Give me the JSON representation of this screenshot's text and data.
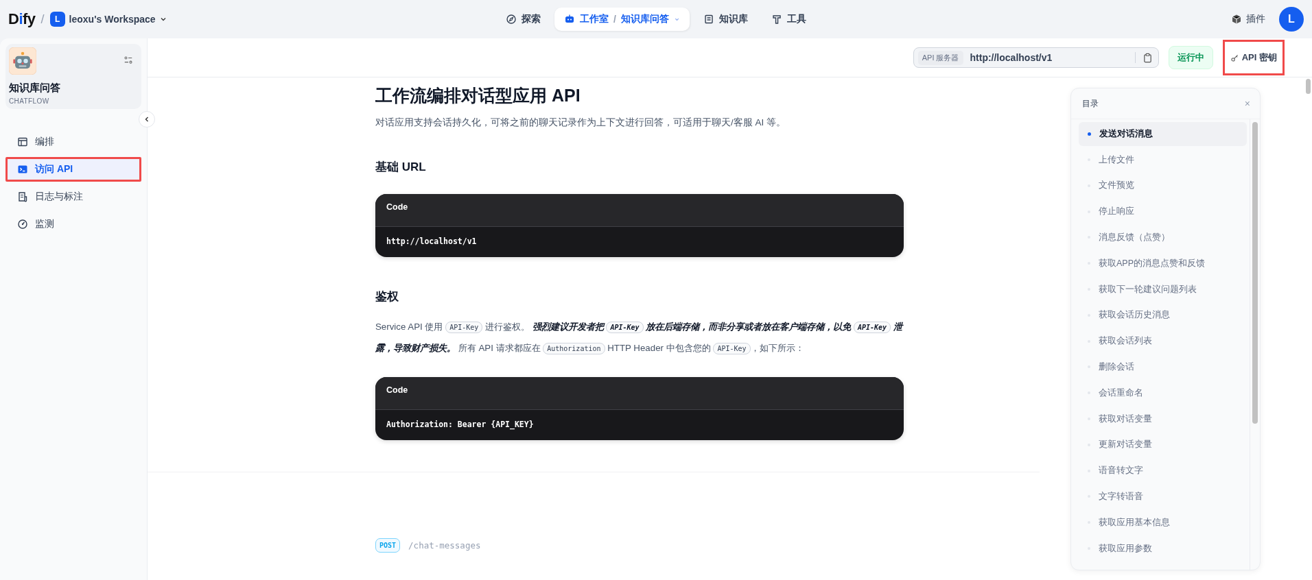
{
  "topbar": {
    "logo": "Dify",
    "separator": "/",
    "workspace": {
      "initial": "L",
      "name": "leoxu's Workspace"
    },
    "nav": [
      {
        "label": "探索",
        "selected": false
      },
      {
        "label": "工作室",
        "selected": true,
        "separator": "/",
        "sub": "知识库问答"
      },
      {
        "label": "知识库",
        "selected": false
      },
      {
        "label": "工具",
        "selected": false
      }
    ],
    "plugins": "插件",
    "avatar": "L"
  },
  "sidebar": {
    "app_name": "知识库问答",
    "app_type": "CHATFLOW",
    "items": [
      {
        "label": "编排",
        "selected": false,
        "highlighted": false
      },
      {
        "label": "访问 API",
        "selected": true,
        "highlighted": true
      },
      {
        "label": "日志与标注",
        "selected": false,
        "highlighted": false
      },
      {
        "label": "监测",
        "selected": false,
        "highlighted": false
      }
    ]
  },
  "header": {
    "server_label": "API 服务器",
    "server_url": "http://localhost/v1",
    "status": "运行中",
    "api_key_button": "API 密钥",
    "api_key_highlighted": true
  },
  "doc": {
    "title": "工作流编排对话型应用 API",
    "intro": "对话应用支持会话持久化，可将之前的聊天记录作为上下文进行回答，可适用于聊天/客服 AI 等。",
    "sections": [
      {
        "heading": "基础 URL",
        "code_label": "Code",
        "code": "http://localhost/v1"
      },
      {
        "heading": "鉴权",
        "paragraph": [
          {
            "kind": "text",
            "text": "Service API 使用 "
          },
          {
            "kind": "code",
            "text": "API-Key"
          },
          {
            "kind": "text",
            "text": " 进行鉴权。 "
          },
          {
            "kind": "strong",
            "text": "强烈建议开发者把 "
          },
          {
            "kind": "strongcode",
            "text": "API-Key"
          },
          {
            "kind": "strong",
            "text": " 放在后端存储，而非分享或者放在客户端存储，以免 "
          },
          {
            "kind": "strongcode",
            "text": "API-Key"
          },
          {
            "kind": "strong",
            "text": " 泄露，导致财产损失。"
          },
          {
            "kind": "text",
            "text": " 所有 API 请求都应在 "
          },
          {
            "kind": "code",
            "text": "Authorization"
          },
          {
            "kind": "text",
            "text": " HTTP Header 中包含您的 "
          },
          {
            "kind": "code",
            "text": "API-Key"
          },
          {
            "kind": "text",
            "text": "，如下所示："
          }
        ],
        "code_label": "Code",
        "code": "Authorization: Bearer {API_KEY}"
      }
    ],
    "endpoint": {
      "method": "POST",
      "path": "/chat-messages"
    }
  },
  "toc": {
    "title": "目录",
    "close": "×",
    "items": [
      {
        "label": "发送对话消息",
        "selected": true
      },
      {
        "label": "上传文件",
        "selected": false
      },
      {
        "label": "文件预览",
        "selected": false
      },
      {
        "label": "停止响应",
        "selected": false
      },
      {
        "label": "消息反馈（点赞）",
        "selected": false
      },
      {
        "label": "获取APP的消息点赞和反馈",
        "selected": false
      },
      {
        "label": "获取下一轮建议问题列表",
        "selected": false
      },
      {
        "label": "获取会话历史消息",
        "selected": false
      },
      {
        "label": "获取会话列表",
        "selected": false
      },
      {
        "label": "删除会话",
        "selected": false
      },
      {
        "label": "会话重命名",
        "selected": false
      },
      {
        "label": "获取对话变量",
        "selected": false
      },
      {
        "label": "更新对话变量",
        "selected": false
      },
      {
        "label": "语音转文字",
        "selected": false
      },
      {
        "label": "文字转语音",
        "selected": false
      },
      {
        "label": "获取应用基本信息",
        "selected": false
      },
      {
        "label": "获取应用参数",
        "selected": false
      }
    ]
  }
}
